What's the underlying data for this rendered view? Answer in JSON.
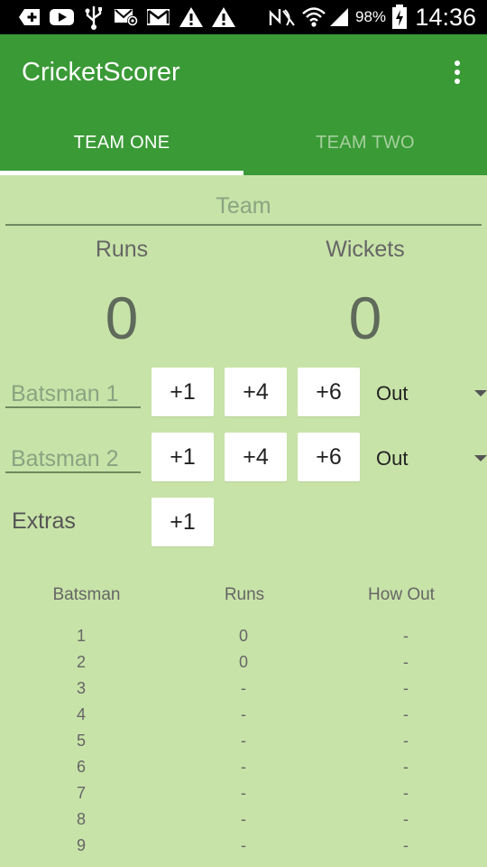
{
  "status_bar": {
    "battery": "98%",
    "time": "14:36"
  },
  "app": {
    "title": "CricketScorer"
  },
  "tabs": [
    {
      "label": "TEAM ONE",
      "selected": true
    },
    {
      "label": "TEAM TWO",
      "selected": false
    }
  ],
  "team": {
    "placeholder": "Team"
  },
  "stats": {
    "runs_label": "Runs",
    "runs_value": "0",
    "wickets_label": "Wickets",
    "wickets_value": "0"
  },
  "batsman_rows": [
    {
      "placeholder": "Batsman 1",
      "buttons": [
        "+1",
        "+4",
        "+6"
      ],
      "out_value": "Out"
    },
    {
      "placeholder": "Batsman 2",
      "buttons": [
        "+1",
        "+4",
        "+6"
      ],
      "out_value": "Out"
    }
  ],
  "extras": {
    "label": "Extras",
    "button": "+1"
  },
  "table": {
    "headers": [
      "Batsman",
      "Runs",
      "How Out"
    ],
    "rows": [
      [
        "1",
        "0",
        "-"
      ],
      [
        "2",
        "0",
        "-"
      ],
      [
        "3",
        "-",
        "-"
      ],
      [
        "4",
        "-",
        "-"
      ],
      [
        "5",
        "-",
        "-"
      ],
      [
        "6",
        "-",
        "-"
      ],
      [
        "7",
        "-",
        "-"
      ],
      [
        "8",
        "-",
        "-"
      ],
      [
        "9",
        "-",
        "-"
      ]
    ]
  },
  "colors": {
    "app_bar": "#3a9a36",
    "background": "#c8e3a8",
    "tab_indicator": "#ffffff"
  }
}
